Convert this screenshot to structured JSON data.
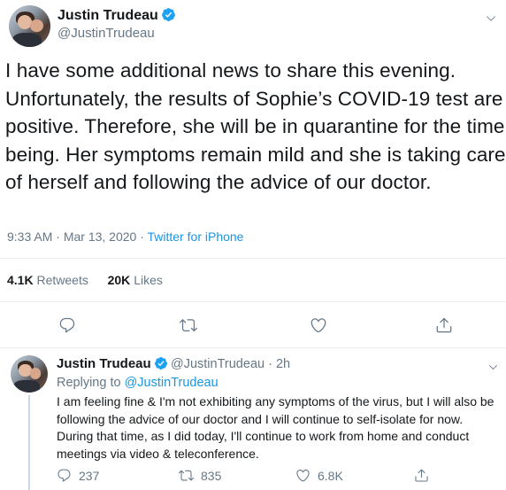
{
  "tweet": {
    "author_name": "Justin Trudeau",
    "author_handle": "@JustinTrudeau",
    "text": "I have some additional news to share this evening. Unfortunately, the results of Sophie’s COVID-19 test are positive. Therefore, she will be in quarantine for the time being. Her symptoms remain mild and she is taking care of herself and following the advice of our doctor.",
    "time": "9:33 AM",
    "separator": " · ",
    "date": "Mar 13, 2020",
    "source": "Twitter for iPhone",
    "retweets_count": "4.1K",
    "retweets_label": "Retweets",
    "likes_count": "20K",
    "likes_label": "Likes"
  },
  "actions": {
    "icons": [
      "comment-icon",
      "retweet-icon",
      "like-icon",
      "share-icon"
    ]
  },
  "reply": {
    "author_name": "Justin Trudeau",
    "author_handle": "@JustinTrudeau",
    "separator": " · ",
    "time": "2h",
    "replying_prefix": "Replying to",
    "replying_handle": "@JustinTrudeau",
    "text": "I am feeling fine & I'm not exhibiting any symptoms of the virus, but I will also be following the advice of our doctor and I will continue to self-isolate for now. During that time, as I did today, I'll continue to work from home and conduct meetings via video & teleconference.",
    "reply_count": "237",
    "retweet_count": "835",
    "like_count": "6.8K"
  },
  "colors": {
    "accent": "#1b95e0",
    "verified": "#1da1f2",
    "secondary_text": "#657786",
    "divider": "#e6ecf0"
  }
}
